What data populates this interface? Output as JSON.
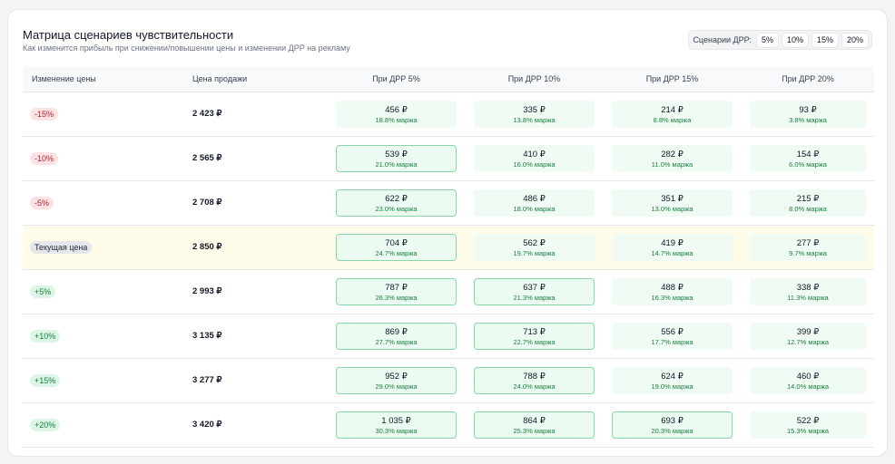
{
  "title": "Матрица сценариев чувствительности",
  "subtitle": "Как изменится прибыль при снижении/повышении цены и изменении ДРР на рекламу",
  "scenarios": {
    "label": "Сценарии ДРР:",
    "options": [
      "5%",
      "10%",
      "15%",
      "20%"
    ]
  },
  "headers": [
    "Изменение цены",
    "Цена продажи",
    "При ДРР 5%",
    "При ДРР 10%",
    "При ДРР 15%",
    "При ДРР 20%"
  ],
  "rows": [
    {
      "change": "-15%",
      "kind": "neg",
      "price": "2 423 ₽",
      "cells": [
        {
          "v": "456 ₽",
          "m": "18.8% маржа",
          "hl": false
        },
        {
          "v": "335 ₽",
          "m": "13.8% маржа",
          "hl": false
        },
        {
          "v": "214 ₽",
          "m": "8.8% маржа",
          "hl": false
        },
        {
          "v": "93 ₽",
          "m": "3.8% маржа",
          "hl": false
        }
      ]
    },
    {
      "change": "-10%",
      "kind": "neg",
      "price": "2 565 ₽",
      "cells": [
        {
          "v": "539 ₽",
          "m": "21.0% маржа",
          "hl": true
        },
        {
          "v": "410 ₽",
          "m": "16.0% маржа",
          "hl": false
        },
        {
          "v": "282 ₽",
          "m": "11.0% маржа",
          "hl": false
        },
        {
          "v": "154 ₽",
          "m": "6.0% маржа",
          "hl": false
        }
      ]
    },
    {
      "change": "-5%",
      "kind": "neg",
      "price": "2 708 ₽",
      "cells": [
        {
          "v": "622 ₽",
          "m": "23.0% маржа",
          "hl": true
        },
        {
          "v": "486 ₽",
          "m": "18.0% маржа",
          "hl": false
        },
        {
          "v": "351 ₽",
          "m": "13.0% маржа",
          "hl": false
        },
        {
          "v": "215 ₽",
          "m": "8.0% маржа",
          "hl": false
        }
      ]
    },
    {
      "change": "Текущая цена",
      "kind": "cur",
      "price": "2 850 ₽",
      "cells": [
        {
          "v": "704 ₽",
          "m": "24.7% маржа",
          "hl": true
        },
        {
          "v": "562 ₽",
          "m": "19.7% маржа",
          "hl": false
        },
        {
          "v": "419 ₽",
          "m": "14.7% маржа",
          "hl": false
        },
        {
          "v": "277 ₽",
          "m": "9.7% маржа",
          "hl": false
        }
      ]
    },
    {
      "change": "+5%",
      "kind": "pos",
      "price": "2 993 ₽",
      "cells": [
        {
          "v": "787 ₽",
          "m": "26.3% маржа",
          "hl": true
        },
        {
          "v": "637 ₽",
          "m": "21.3% маржа",
          "hl": true
        },
        {
          "v": "488 ₽",
          "m": "16.3% маржа",
          "hl": false
        },
        {
          "v": "338 ₽",
          "m": "11.3% маржа",
          "hl": false
        }
      ]
    },
    {
      "change": "+10%",
      "kind": "pos",
      "price": "3 135 ₽",
      "cells": [
        {
          "v": "869 ₽",
          "m": "27.7% маржа",
          "hl": true
        },
        {
          "v": "713 ₽",
          "m": "22.7% маржа",
          "hl": true
        },
        {
          "v": "556 ₽",
          "m": "17.7% маржа",
          "hl": false
        },
        {
          "v": "399 ₽",
          "m": "12.7% маржа",
          "hl": false
        }
      ]
    },
    {
      "change": "+15%",
      "kind": "pos",
      "price": "3 277 ₽",
      "cells": [
        {
          "v": "952 ₽",
          "m": "29.0% маржа",
          "hl": true
        },
        {
          "v": "788 ₽",
          "m": "24.0% маржа",
          "hl": true
        },
        {
          "v": "624 ₽",
          "m": "19.0% маржа",
          "hl": false
        },
        {
          "v": "460 ₽",
          "m": "14.0% маржа",
          "hl": false
        }
      ]
    },
    {
      "change": "+20%",
      "kind": "pos",
      "price": "3 420 ₽",
      "cells": [
        {
          "v": "1 035 ₽",
          "m": "30.3% маржа",
          "hl": true
        },
        {
          "v": "864 ₽",
          "m": "25.3% маржа",
          "hl": true
        },
        {
          "v": "693 ₽",
          "m": "20.3% маржа",
          "hl": true
        },
        {
          "v": "522 ₽",
          "m": "15.3% маржа",
          "hl": false
        }
      ]
    }
  ]
}
